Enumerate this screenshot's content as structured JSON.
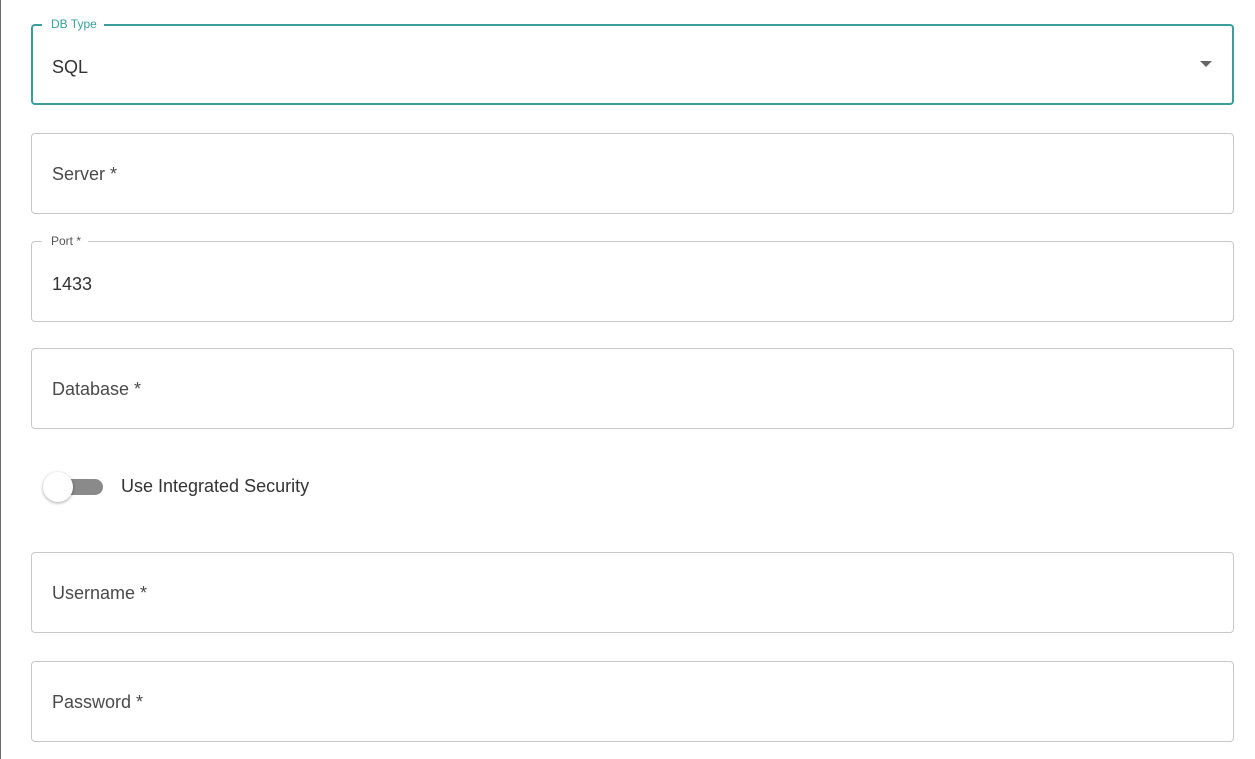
{
  "db_type": {
    "label": "DB Type",
    "value": "SQL"
  },
  "server": {
    "placeholder": "Server *"
  },
  "port": {
    "label": "Port *",
    "value": "1433"
  },
  "database": {
    "placeholder": "Database *"
  },
  "integrated_security": {
    "label": "Use Integrated Security",
    "enabled": false
  },
  "username": {
    "placeholder": "Username *"
  },
  "password": {
    "placeholder": "Password *"
  },
  "colors": {
    "accent": "#3a9e9c",
    "border": "#c8c8c8",
    "toggle_track": "#8a8a8a"
  },
  "icons": {
    "dropdown": "chevron-down-icon"
  }
}
